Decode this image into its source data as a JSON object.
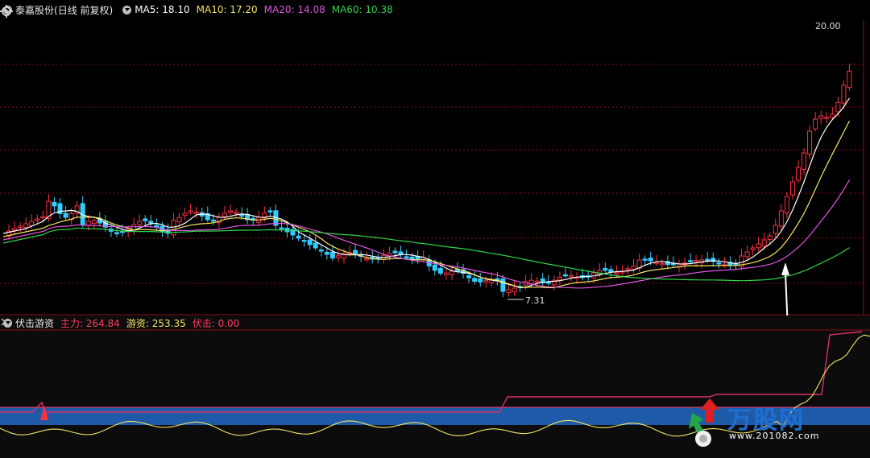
{
  "chart": {
    "stock_name": "泰嘉股份",
    "period_label": "(日线 前复权)",
    "price_top_label": "20.00",
    "low_marker_label": "7.31"
  },
  "ma_legend": [
    {
      "label": "MA5: 18.10",
      "color": "#ffffff"
    },
    {
      "label": "MA10: 17.20",
      "color": "#f5e663"
    },
    {
      "label": "MA20: 14.08",
      "color": "#e055e0"
    },
    {
      "label": "MA60: 10.38",
      "color": "#2fd44a"
    }
  ],
  "indicator": {
    "name": "伏击游资",
    "items": [
      {
        "label": "主力: 264.84",
        "color": "#ff3b5b"
      },
      {
        "label": "游资: 253.35",
        "color": "#f5e663"
      },
      {
        "label": "伏击: 0.00",
        "color": "#ff3b5b"
      }
    ]
  },
  "watermark": {
    "brand": "万股网",
    "url": "www.201082.com"
  },
  "colors": {
    "up": "#ff3040",
    "down": "#33ccff",
    "grid": "#8a0f1e",
    "band": "#1e5aa8"
  },
  "icons": {
    "settings": "settings-icon",
    "close": "close-icon",
    "indicator_dropdown": "chevron-down-icon"
  }
}
